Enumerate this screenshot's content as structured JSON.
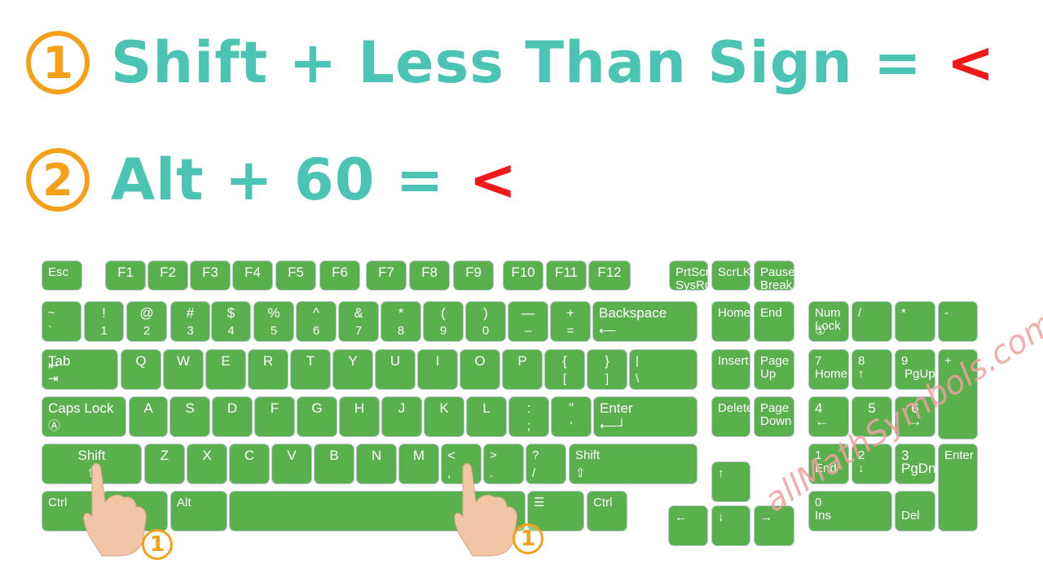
{
  "methods": [
    {
      "number": "1",
      "text": "Shift + Less Than Sign =",
      "result": "<"
    },
    {
      "number": "2",
      "text": "Alt + 60 =",
      "result": "<"
    }
  ],
  "colors": {
    "key": "#5ab04d",
    "heading": "#4cc4b3",
    "number": "#f5a016",
    "symbol": "#f01818"
  },
  "keys": [
    {
      "t": "Esc"
    },
    {
      "t": "F1"
    },
    {
      "t": "F2"
    },
    {
      "t": "F3"
    },
    {
      "t": "F4"
    },
    {
      "t": "F5"
    },
    {
      "t": "F6"
    },
    {
      "t": "F7"
    },
    {
      "t": "F8"
    },
    {
      "t": "F9"
    },
    {
      "t": "F10"
    },
    {
      "t": "F11"
    },
    {
      "t": "F12"
    },
    {
      "t": "PrtScn\nSysRq"
    },
    {
      "t": "ScrLK⬇"
    },
    {
      "t": "Pause\nBreak"
    },
    {
      "t": "~",
      "b": "`"
    },
    {
      "t": "!",
      "b": "1"
    },
    {
      "t": "@",
      "b": "2"
    },
    {
      "t": "#",
      "b": "3"
    },
    {
      "t": "$",
      "b": "4"
    },
    {
      "t": "%",
      "b": "5"
    },
    {
      "t": "^",
      "b": "6"
    },
    {
      "t": "&",
      "b": "7"
    },
    {
      "t": "*",
      "b": "8"
    },
    {
      "t": "(",
      "b": "9"
    },
    {
      "t": ")",
      "b": "0"
    },
    {
      "t": "—",
      "b": "–"
    },
    {
      "t": "+",
      "b": "="
    },
    {
      "t": "Backspace",
      "b": "⟵"
    },
    {
      "t": "Home"
    },
    {
      "t": "End"
    },
    {
      "t": "Num\nLock",
      "b": "①"
    },
    {
      "t": "/"
    },
    {
      "t": "*"
    },
    {
      "t": "-"
    },
    {
      "t": "Tab",
      "b": "⇤\n⇥"
    },
    {
      "t": "Q"
    },
    {
      "t": "W"
    },
    {
      "t": "E"
    },
    {
      "t": "R"
    },
    {
      "t": "T"
    },
    {
      "t": "Y"
    },
    {
      "t": "U"
    },
    {
      "t": "I"
    },
    {
      "t": "O"
    },
    {
      "t": "P"
    },
    {
      "t": "{",
      "b": "["
    },
    {
      "t": "}",
      "b": "]"
    },
    {
      "t": "|",
      "b": "\\"
    },
    {
      "t": "Insert"
    },
    {
      "t": "Page\nUp"
    },
    {
      "t": "7\nHome"
    },
    {
      "t": "8\n↑"
    },
    {
      "t": "9\n PgUp"
    },
    {
      "t": "+"
    },
    {
      "t": "Caps Lock",
      "b": "Ⓐ"
    },
    {
      "t": "A"
    },
    {
      "t": "S"
    },
    {
      "t": "D"
    },
    {
      "t": "F"
    },
    {
      "t": "G"
    },
    {
      "t": "H"
    },
    {
      "t": "J"
    },
    {
      "t": "K"
    },
    {
      "t": "L"
    },
    {
      "t": ":",
      "b": ";"
    },
    {
      "t": "\"",
      "b": "'"
    },
    {
      "t": "Enter",
      "b": "⟵┘"
    },
    {
      "t": "Delete"
    },
    {
      "t": "Page\nDown"
    },
    {
      "t": "4\n←"
    },
    {
      "t": "5"
    },
    {
      "t": "6\n→"
    },
    {
      "t": "Shift",
      "b": "⇧"
    },
    {
      "t": "Z"
    },
    {
      "t": "X"
    },
    {
      "t": "C"
    },
    {
      "t": "V"
    },
    {
      "t": "B"
    },
    {
      "t": "N"
    },
    {
      "t": "M"
    },
    {
      "t": "<",
      "b": ","
    },
    {
      "t": ">",
      "b": "."
    },
    {
      "t": "?",
      "b": "/"
    },
    {
      "t": "Shift",
      "b": "⇧"
    },
    {
      "t": "↑"
    },
    {
      "t": "1\nEnd"
    },
    {
      "t": "2\n↓"
    },
    {
      "t": "3\nPgDn"
    },
    {
      "t": "Enter"
    },
    {
      "t": "Ctrl"
    },
    {
      "t": "Start"
    },
    {
      "t": "Alt"
    },
    {
      "t": ""
    },
    {
      "t": "☰"
    },
    {
      "t": "Ctrl"
    },
    {
      "t": "←"
    },
    {
      "t": "↓"
    },
    {
      "t": "→"
    },
    {
      "t": "0\nIns"
    },
    {
      "t": "\nDel"
    }
  ],
  "hand_markers": [
    "1",
    "1"
  ],
  "watermark": "allMathSymbols.com"
}
